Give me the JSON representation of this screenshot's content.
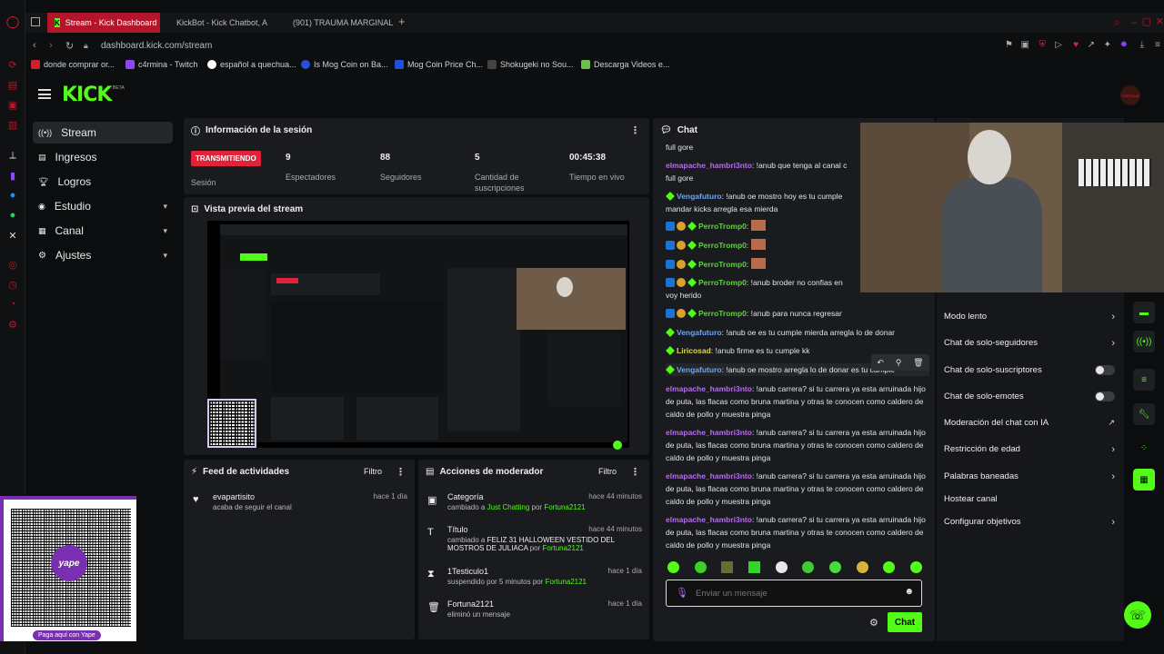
{
  "browser": {
    "tabs": [
      {
        "label": "Stream - Kick Dashboard"
      },
      {
        "label": "KickBot - Kick Chatbot, A"
      },
      {
        "label": "(901) TRAUMA MARGINAL"
      }
    ],
    "url": "dashboard.kick.com/stream",
    "bookmarks": [
      {
        "label": "donde comprar or...",
        "color": "#d21f2f"
      },
      {
        "label": "c4rmina - Twitch",
        "color": "#8f45f7"
      },
      {
        "label": "español a quechua...",
        "color": "#ffffff"
      },
      {
        "label": "Is Mog Coin on Ba...",
        "color": "#2450d9"
      },
      {
        "label": "Mog Coin Price Ch...",
        "color": "#2450d9"
      },
      {
        "label": "Shokugeki no Sou...",
        "color": "#444444"
      },
      {
        "label": "Descarga Videos e...",
        "color": "#6cc04a"
      }
    ]
  },
  "kick": {
    "logo": "KICK",
    "beta": "BETA",
    "avatar_text": "FORTUNA"
  },
  "nav": [
    {
      "label": "Stream"
    },
    {
      "label": "Ingresos"
    },
    {
      "label": "Logros"
    },
    {
      "label": "Estudio"
    },
    {
      "label": "Canal"
    },
    {
      "label": "Ajustes"
    }
  ],
  "session": {
    "title": "Información de la sesión",
    "status": "TRANSMITIENDO",
    "status_label": "Sesión",
    "viewers": "9",
    "viewers_label": "Espectadores",
    "followers": "88",
    "followers_label": "Seguidores",
    "subs": "5",
    "subs_label": "Cantidad de suscripciones",
    "uptime": "00:45:38",
    "uptime_label": "Tiempo en vivo"
  },
  "preview": {
    "title": "Vista previa del stream"
  },
  "activity": {
    "title": "Feed de actividades",
    "filter": "Filtro",
    "items": [
      {
        "user": "evapartisito",
        "action": "acaba de seguir el canal",
        "time": "hace 1 día"
      }
    ]
  },
  "modactions": {
    "title": "Acciones de moderador",
    "filter": "Filtro",
    "items": [
      {
        "title": "Categoría",
        "pre": "cambiado a ",
        "val": "Just Chatting",
        "by": " por ",
        "mod": "Fortuna2121",
        "time": "hace 44 minutos"
      },
      {
        "title": "Título",
        "pre": "cambiado a ",
        "val": "FELIZ 31 HALLOWEEN VESTIDO DEL MOSTROS DE JULIACA",
        "by": " por ",
        "mod": "Fortuna2121",
        "time": "hace 44 minutos"
      },
      {
        "title": "1Testiculo1",
        "pre": "suspendido por 5 minutos",
        "val": "",
        "by": " por ",
        "mod": "Fortuna2121",
        "time": "hace 1 día"
      },
      {
        "title": "Fortuna2121",
        "pre": "eliminó un mensaje",
        "val": "",
        "by": "",
        "mod": "",
        "time": "hace 1 día"
      }
    ]
  },
  "chat": {
    "title": "Chat",
    "messages": [
      {
        "user": "",
        "text": "full gore",
        "color": "#e2e4e6"
      },
      {
        "user": "elmapache_hambri3nto",
        "text": ": !anub que tenga al canal c",
        "color": "#b56cf0"
      },
      {
        "user": "",
        "text": "full gore",
        "color": "#e2e4e6"
      },
      {
        "user": "Vengafuturo",
        "text": ": !anub oe mostro hoy es tu cumple",
        "color": "#6aa7f5"
      },
      {
        "user": "",
        "text": "mandar kicks arregla esa mierda",
        "color": "#e2e4e6"
      },
      {
        "user": "PerroTromp0",
        "text": ":",
        "color": "#5ed33d"
      },
      {
        "user": "PerroTromp0",
        "text": ":",
        "color": "#5ed33d"
      },
      {
        "user": "PerroTromp0",
        "text": ":",
        "color": "#5ed33d"
      },
      {
        "user": "PerroTromp0",
        "text": ": !anub broder no confias en",
        "color": "#5ed33d"
      },
      {
        "user": "",
        "text": "voy herido",
        "color": "#e2e4e6"
      },
      {
        "user": "PerroTromp0",
        "text": ": !anub para nunca regresar",
        "color": "#5ed33d"
      },
      {
        "user": "Vengafuturo",
        "text": ": !anub oe es tu cumple mierda arregla lo de donar",
        "color": "#6aa7f5"
      },
      {
        "user": "Liricosad",
        "text": ": !anub firme es tu cumple kk",
        "color": "#e3d84a"
      },
      {
        "user": "Vengafuturo",
        "text": ": !anub oe mostro arregla lo de donar es tu cumple",
        "color": "#6aa7f5"
      },
      {
        "user": "elmapache_hambri3nto",
        "text": ": !anub carrera? si tu carrera ya esta arruinada hijo de puta, las flacas como bruna martina y otras te conocen como caldero de caldo de pollo y muestra pinga",
        "color": "#b56cf0"
      },
      {
        "user": "elmapache_hambri3nto",
        "text": ": !anub carrera? si tu carrera ya esta arruinada hijo de puta, las flacas como bruna martina y otras te conocen como caldero de caldo de pollo y muestra pinga",
        "color": "#b56cf0"
      },
      {
        "user": "elmapache_hambri3nto",
        "text": ": !anub carrera? si tu carrera ya esta arruinada hijo de puta, las flacas como bruna martina y otras te conocen como caldero de caldo de pollo y muestra pinga",
        "color": "#b56cf0"
      },
      {
        "user": "elmapache_hambri3nto",
        "text": ": !anub carrera? si tu carrera ya esta arruinada hijo de puta, las flacas como bruna martina y otras te conocen como caldero de caldo de pollo y muestra pinga",
        "color": "#b56cf0"
      }
    ],
    "placeholder": "Enviar un mensaje",
    "send": "Chat"
  },
  "settings": [
    {
      "label": "Modo lento",
      "ctrl": "arrow"
    },
    {
      "label": "Chat de solo-seguidores",
      "ctrl": "arrow"
    },
    {
      "label": "Chat de solo-suscriptores",
      "ctrl": "toggle"
    },
    {
      "label": "Chat de solo-emotes",
      "ctrl": "toggle"
    },
    {
      "label": "Moderación del chat con IA",
      "ctrl": "ext"
    },
    {
      "label": "Restricción de edad",
      "ctrl": "arrow"
    },
    {
      "label": "Palabras baneadas",
      "ctrl": "arrow"
    },
    {
      "label": "Hostear canal",
      "ctrl": "none"
    },
    {
      "label": "Configurar objetivos",
      "ctrl": "arrow"
    }
  ],
  "overlay": {
    "yape_label": "Paga aquí con Yape",
    "yape_brand": "yape"
  }
}
